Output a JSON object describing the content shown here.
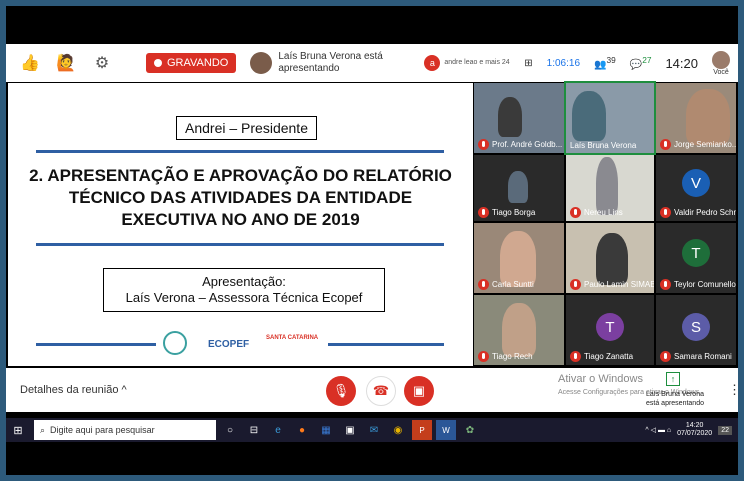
{
  "topbar": {
    "recording_label": "GRAVANDO",
    "presenter_text": "Laís Bruna Verona está apresentando",
    "andre_badge": "a",
    "andre_text": "andre leao e mais 24",
    "timer": "1:06:16",
    "participants": "39",
    "chat_count": "27",
    "clock": "14:20",
    "you_label": "Você"
  },
  "slide": {
    "presidente": "Andrei – Presidente",
    "title": "2. APRESENTAÇÃO E APROVAÇÃO DO RELATÓRIO TÉCNICO DAS ATIVIDADES DA ENTIDADE EXECUTIVA NO ANO DE 2019",
    "apres_line1": "Apresentação:",
    "apres_line2": "Laís Verona – Assessora Técnica Ecopef",
    "logo_ecopef": "ECOPEF",
    "logo_sc": "SANTA CATARINA"
  },
  "participants": [
    {
      "name": "Prof. André Goldb..."
    },
    {
      "name": "Laís Bruna Verona"
    },
    {
      "name": "Jorge Semianko..."
    },
    {
      "name": "Tiago Borga"
    },
    {
      "name": "Nereu Lins"
    },
    {
      "name": "Valdir Pedro Schne...",
      "letter": "V",
      "color": "#1a5fb4"
    },
    {
      "name": "Carla Suntti"
    },
    {
      "name": "Paulo Lamin SIMAE"
    },
    {
      "name": "Teylor Comunello",
      "letter": "T",
      "color": "#1e6e3a"
    },
    {
      "name": "Tiago Rech"
    },
    {
      "name": "Tiago Zanatta",
      "letter": "T",
      "color": "#7b3fa0"
    },
    {
      "name": "Samara Romani",
      "letter": "S",
      "color": "#5c5ca8"
    }
  ],
  "meetbar": {
    "details": "Detalhes da reunião",
    "activate_title": "Ativar o Windows",
    "activate_sub": "Acesse Configurações para ativar o Windows.",
    "popup_line1": "Laís Bruna Verona",
    "popup_line2": "está apresentando"
  },
  "taskbar": {
    "search_placeholder": "Digite aqui para pesquisar",
    "time": "14:20",
    "date": "07/07/2020",
    "notif": "22"
  }
}
